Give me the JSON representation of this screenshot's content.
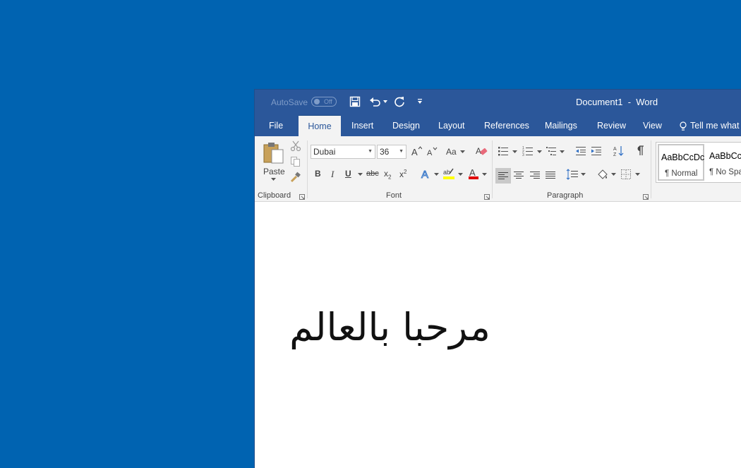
{
  "titlebar": {
    "autosave_label": "AutoSave",
    "autosave_state": "Off",
    "document_title": "Document1  -  Word"
  },
  "tabs": [
    {
      "label": "File"
    },
    {
      "label": "Home"
    },
    {
      "label": "Insert"
    },
    {
      "label": "Design"
    },
    {
      "label": "Layout"
    },
    {
      "label": "References"
    },
    {
      "label": "Mailings"
    },
    {
      "label": "Review"
    },
    {
      "label": "View"
    }
  ],
  "active_tab": "Home",
  "tell_me": "Tell me what",
  "ribbon": {
    "clipboard": {
      "paste_label": "Paste",
      "group_label": "Clipboard"
    },
    "font": {
      "font_name": "Dubai",
      "font_size": "36",
      "change_case": "Aa",
      "bold": "B",
      "italic": "I",
      "underline": "U",
      "strikethrough": "abc",
      "subscript": "x",
      "superscript": "x",
      "group_label": "Font"
    },
    "paragraph": {
      "group_label": "Paragraph"
    },
    "styles": [
      {
        "preview": "AaBbCcDc",
        "name": "¶ Normal"
      },
      {
        "preview": "AaBbCc",
        "name": "¶ No Spa"
      }
    ]
  },
  "colors": {
    "desktop": "#0063b1",
    "word_blue": "#2b579a",
    "highlight_yellow": "#ffff00",
    "font_red": "#e00000"
  },
  "document": {
    "text": "مرحبا بالعالم"
  }
}
